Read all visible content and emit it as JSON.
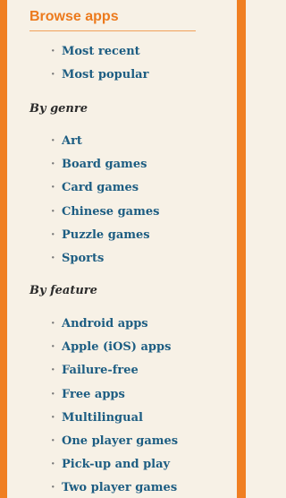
{
  "heading": "Browse apps",
  "browse": [
    "Most recent",
    "Most popular"
  ],
  "genre": {
    "label": "By genre",
    "items": [
      "Art",
      "Board games",
      "Card games",
      "Chinese games",
      "Puzzle games",
      "Sports"
    ]
  },
  "feature": {
    "label": "By feature",
    "items": [
      "Android apps",
      "Apple (iOS) apps",
      "Failure-free",
      "Free apps",
      "Multilingual",
      "One player games",
      "Pick-up and play",
      "Two player games"
    ]
  },
  "bullet": "·",
  "colors": {
    "border": "#f07f22",
    "heading": "#ec7a1d",
    "link": "#1d5d82",
    "background": "#f7f1e6"
  }
}
